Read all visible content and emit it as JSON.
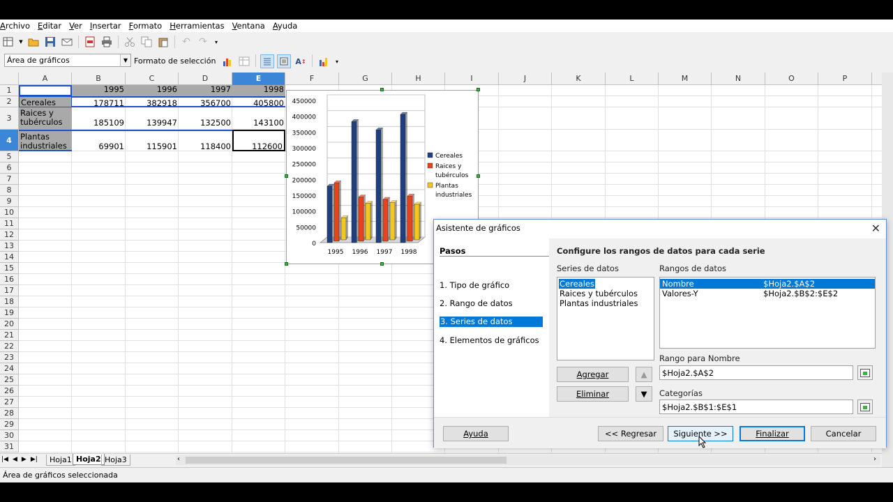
{
  "menu": [
    "Archivo",
    "Editar",
    "Ver",
    "Insertar",
    "Formato",
    "Herramientas",
    "Ventana",
    "Ayuda"
  ],
  "toolbar2": {
    "name_box": "Área de gráficos",
    "format_selection": "Formato de selección"
  },
  "sheet": {
    "columns": [
      "A",
      "B",
      "C",
      "D",
      "E",
      "F",
      "G",
      "H",
      "I",
      "J",
      "K",
      "L",
      "M",
      "N",
      "O",
      "P"
    ],
    "rows": [
      "1",
      "2",
      "3",
      "4",
      "5",
      "6",
      "7",
      "8",
      "9",
      "10",
      "11",
      "12",
      "13",
      "14",
      "15",
      "16",
      "17",
      "18",
      "19",
      "20",
      "21",
      "22",
      "23",
      "24",
      "25",
      "26",
      "27",
      "28",
      "29",
      "30",
      "31"
    ],
    "header_years": [
      "1995",
      "1996",
      "1997",
      "1998"
    ],
    "row_labels": [
      "Cereales",
      "Raices y tubérculos",
      "Plantas industriales"
    ],
    "values": [
      [
        "178711",
        "382918",
        "356700",
        "405800"
      ],
      [
        "185109",
        "139947",
        "132500",
        "143100"
      ],
      [
        "69901",
        "115901",
        "118400",
        "112600"
      ]
    ]
  },
  "chart_data": {
    "type": "bar",
    "categories": [
      "1995",
      "1996",
      "1997",
      "1998"
    ],
    "series": [
      {
        "name": "Cereales",
        "values": [
          178711,
          382918,
          356700,
          405800
        ],
        "color": "#1f3f7f"
      },
      {
        "name": "Raices y tubérculos",
        "values": [
          185109,
          139947,
          132500,
          143100
        ],
        "color": "#e8431c"
      },
      {
        "name": "Plantas industriales",
        "values": [
          69901,
          115901,
          118400,
          112600
        ],
        "color": "#f2c81e"
      }
    ],
    "y_ticks": [
      "450000",
      "400000",
      "350000",
      "300000",
      "250000",
      "200000",
      "150000",
      "100000",
      "50000",
      "0"
    ],
    "ylim": [
      0,
      450000
    ],
    "legend": [
      "Cereales",
      "Raices y",
      "tubérculos",
      "Plantas",
      "industriales"
    ],
    "legend_position": "right"
  },
  "tabs": [
    "Hoja1",
    "Hoja2",
    "Hoja3"
  ],
  "active_tab": "Hoja2",
  "status": "Área de gráficos seleccionada",
  "dialog": {
    "title": "Asistente de gráficos",
    "steps_header": "Pasos",
    "steps": [
      "1. Tipo de gráfico",
      "2. Rango de datos",
      "3. Series de datos",
      "4. Elementos de gráficos"
    ],
    "heading": "Configure los rangos de datos para cada serie",
    "series_label": "Series de datos",
    "series_list": [
      "Cereales",
      "Raices y tubérculos",
      "Plantas industriales"
    ],
    "ranges_label": "Rangos de datos",
    "ranges": [
      {
        "name": "Nombre",
        "value": "$Hoja2.$A$2"
      },
      {
        "name": "Valores-Y",
        "value": "$Hoja2.$B$2:$E$2"
      }
    ],
    "name_range_label": "Rango para Nombre",
    "name_range_value": "$Hoja2.$A$2",
    "categories_label": "Categorías",
    "categories_value": "$Hoja2.$B$1:$E$1",
    "add_label": "Agregar",
    "remove_label": "Eliminar",
    "help_label": "Ayuda",
    "back_label": "<< Regresar",
    "next_label": "Siguiente >>",
    "finish_label": "Finalizar",
    "cancel_label": "Cancelar"
  }
}
